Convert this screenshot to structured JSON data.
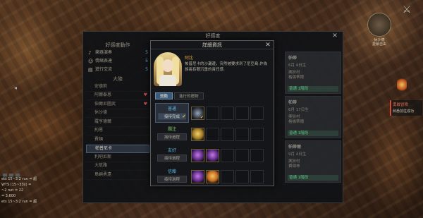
{
  "panel": {
    "title": "好感度",
    "close": "✕",
    "left_header": "好感度動作",
    "options": [
      {
        "icon": "music-note-icon",
        "glyph": "♪",
        "label": "樂器演奏",
        "count": "5"
      },
      {
        "icon": "mask-icon",
        "glyph": "☺",
        "label": "情緒表達",
        "count": "5"
      },
      {
        "icon": "book-icon",
        "glyph": "▤",
        "label": "進行交流",
        "count": "5"
      }
    ],
    "section_label": "大陸",
    "npcs": [
      {
        "name": "安德莉",
        "heart": ""
      },
      {
        "name": "阿爾泰恩",
        "heart": "♥"
      },
      {
        "name": "伯爾尼圖武",
        "heart": "♥"
      },
      {
        "name": "休沙德",
        "heart": ""
      },
      {
        "name": "羅亨德爾",
        "heart": ""
      },
      {
        "name": "約恩",
        "heart": ""
      },
      {
        "name": "費頓",
        "heart": ""
      },
      {
        "name": "帕普尼卡",
        "heart": ""
      },
      {
        "name": "利吧尼斯",
        "heart": ""
      },
      {
        "name": "大航路",
        "heart": ""
      },
      {
        "name": "島嶼勇遠",
        "heart": ""
      }
    ],
    "cards": [
      {
        "name": "帕蒂",
        "date": "6月 4日生",
        "loc": "奧狄村\n格倫蒂爾",
        "status": "普通 1階段"
      },
      {
        "name": "帕蒂",
        "date": "6月 17日生",
        "loc": "奧狄村\n格倫蒂爾",
        "status": "普通 1階段"
      },
      {
        "name": "帕蒂爾",
        "date": "9月 4日生",
        "loc": "奧狄村\n費頓林",
        "status": "普通 1階段"
      }
    ]
  },
  "detail": {
    "title": "詳細資訊",
    "close": "✕",
    "npc_name": "阿比",
    "description": "帕普尼卡的沙灘邊，突然被要求到了尼亞島,作為族長有著沉重的責任感.",
    "tabs": [
      "獎勵",
      "進行的禮物"
    ],
    "levels": [
      {
        "name": "普通",
        "color": "#5fb0e0",
        "button": "接待完成",
        "done": true
      },
      {
        "name": "關注",
        "color": "#7ec66a",
        "button": "接待過程",
        "done": false
      },
      {
        "name": "友好",
        "color": "#5fb0e0",
        "button": "接待過程",
        "done": false
      },
      {
        "name": "信賴",
        "color": "#5fb0e0",
        "button": "接待過程",
        "done": false
      }
    ]
  },
  "hud": {
    "minimap_label": "休沙德\n愛慕自由",
    "quest_title": "勇敢冒險",
    "quest_sub": "熟悉前往成功",
    "chat_lines": [
      "ets 15~3:2 run = 超",
      "WTS (15~33x) =",
      "~2 run = 22",
      "= 3,600",
      "ets 15~3:2 run = 超"
    ]
  }
}
